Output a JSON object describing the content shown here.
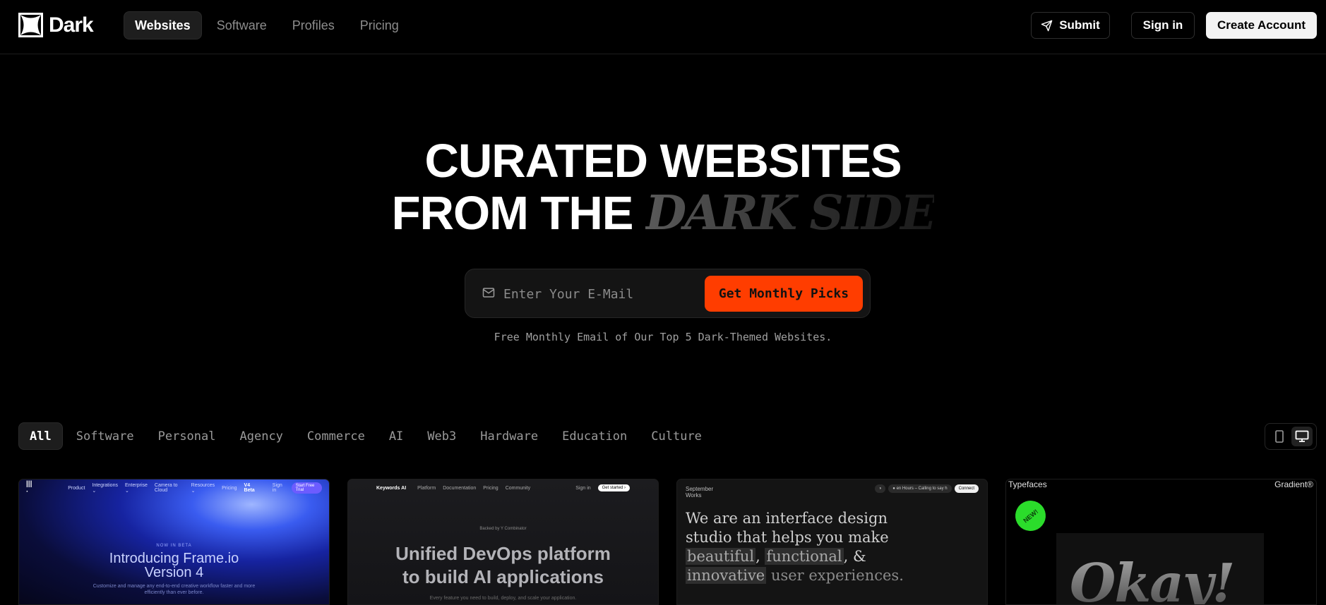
{
  "header": {
    "logo_text": "Dark",
    "nav": [
      {
        "label": "Websites",
        "active": true
      },
      {
        "label": "Software",
        "active": false
      },
      {
        "label": "Profiles",
        "active": false
      },
      {
        "label": "Pricing",
        "active": false
      }
    ],
    "submit_label": "Submit",
    "signin_label": "Sign in",
    "create_label": "Create Account"
  },
  "hero": {
    "title_line1": "CURATED WEBSITES",
    "title_line2_prefix": "FROM THE",
    "title_line2_emphasis": "DARK SIDE",
    "email_placeholder": "Enter Your E-Mail",
    "cta_label": "Get Monthly Picks",
    "subtext": "Free Monthly Email of Our Top 5 Dark-Themed Websites."
  },
  "filters": [
    {
      "label": "All",
      "active": true
    },
    {
      "label": "Software"
    },
    {
      "label": "Personal"
    },
    {
      "label": "Agency"
    },
    {
      "label": "Commerce"
    },
    {
      "label": "AI"
    },
    {
      "label": "Web3"
    },
    {
      "label": "Hardware"
    },
    {
      "label": "Education"
    },
    {
      "label": "Culture"
    }
  ],
  "view_toggle": {
    "mobile_icon": "phone-icon",
    "desktop_icon": "monitor-icon",
    "selected": "desktop"
  },
  "cards": {
    "frame": {
      "nav": [
        "Product",
        "Integrations ⌄",
        "Enterprise ⌄",
        "Camera to Cloud",
        "Resources ⌄",
        "Pricing",
        "V4 Beta"
      ],
      "signin": "Sign in",
      "cta": "Start Free Trial",
      "tag": "NOW IN BETA",
      "title_line1": "Introducing Frame.io",
      "title_line2": "Version 4",
      "desc_line1": "Customize and manage any end-to-end creative workflow faster and more",
      "desc_line2": "efficiently than ever before."
    },
    "keywords": {
      "brand": "Keywords AI",
      "nav": [
        "Platform",
        "Documentation",
        "Pricing",
        "Community"
      ],
      "signin": "Sign in",
      "cta": "Get started ›",
      "badge": "Backed by Y Combinator",
      "title_line1": "Unified DevOps platform",
      "title_line2": "to build AI applications",
      "desc": "Every feature you need to build, deploy, and scale your application."
    },
    "september": {
      "logo_line1": "September",
      "logo_line2": "Works",
      "pill_status": "● en Hours – Calling to say h",
      "pill_connect": "Connect",
      "text_1": "We are an interface design studio that helps you make",
      "hl_1": "beautiful",
      "sep_1": ",",
      "hl_2": "functional",
      "sep_2": ", &",
      "hl_3": "innovative",
      "text_2": "user experiences."
    },
    "gradient": {
      "left_label": "Typefaces",
      "right_label": "Gradient®",
      "badge": "NEW!",
      "word": "Okay!"
    }
  },
  "colors": {
    "accent": "#ff3d00",
    "background": "#000000",
    "badge_green": "#2bdc2b"
  }
}
